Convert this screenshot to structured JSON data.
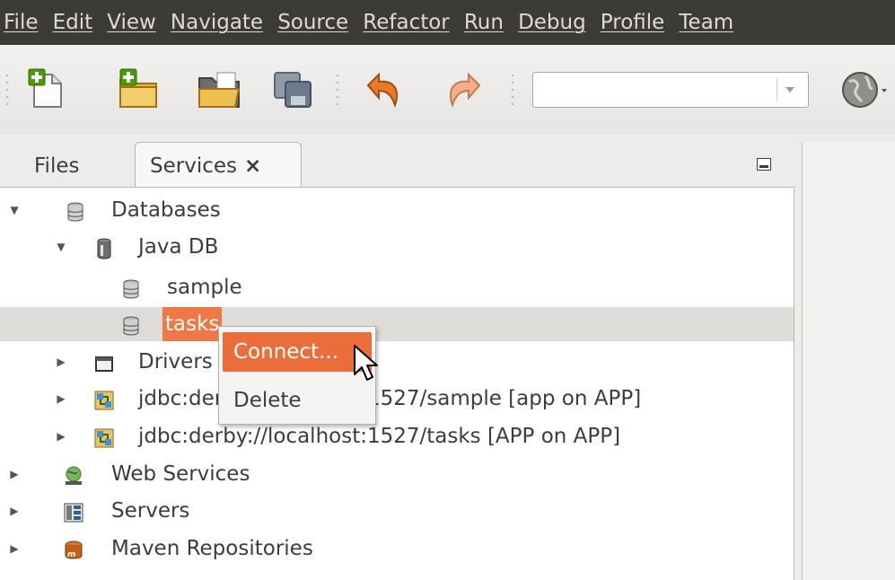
{
  "menubar": {
    "items": [
      "File",
      "Edit",
      "View",
      "Navigate",
      "Source",
      "Refactor",
      "Run",
      "Debug",
      "Profile",
      "Team"
    ]
  },
  "toolbar": {
    "buttons": [
      "new-file-icon",
      "new-project-icon",
      "open-project-icon",
      "save-all-icon",
      "undo-icon",
      "redo-icon"
    ],
    "combo_value": "",
    "globe_icon": "globe-icon"
  },
  "panel": {
    "tabs": {
      "files": "Files",
      "services": "Services",
      "close": "×"
    }
  },
  "tree": {
    "databases": "Databases",
    "java_db": "Java DB",
    "sample": "sample",
    "tasks": "tasks",
    "drivers": "Drivers",
    "conn1": "jdbc:derby://localhost:1527/sample [app on APP]",
    "conn2": "jdbc:derby://localhost:1527/tasks [APP on APP]",
    "web_services": "Web Services",
    "servers": "Servers",
    "maven": "Maven Repositories"
  },
  "context_menu": {
    "connect": "Connect...",
    "delete": "Delete"
  },
  "colors": {
    "accent": "#f07746",
    "menubar_bg": "#3c3b37",
    "selected_row": "#dedcd9"
  }
}
